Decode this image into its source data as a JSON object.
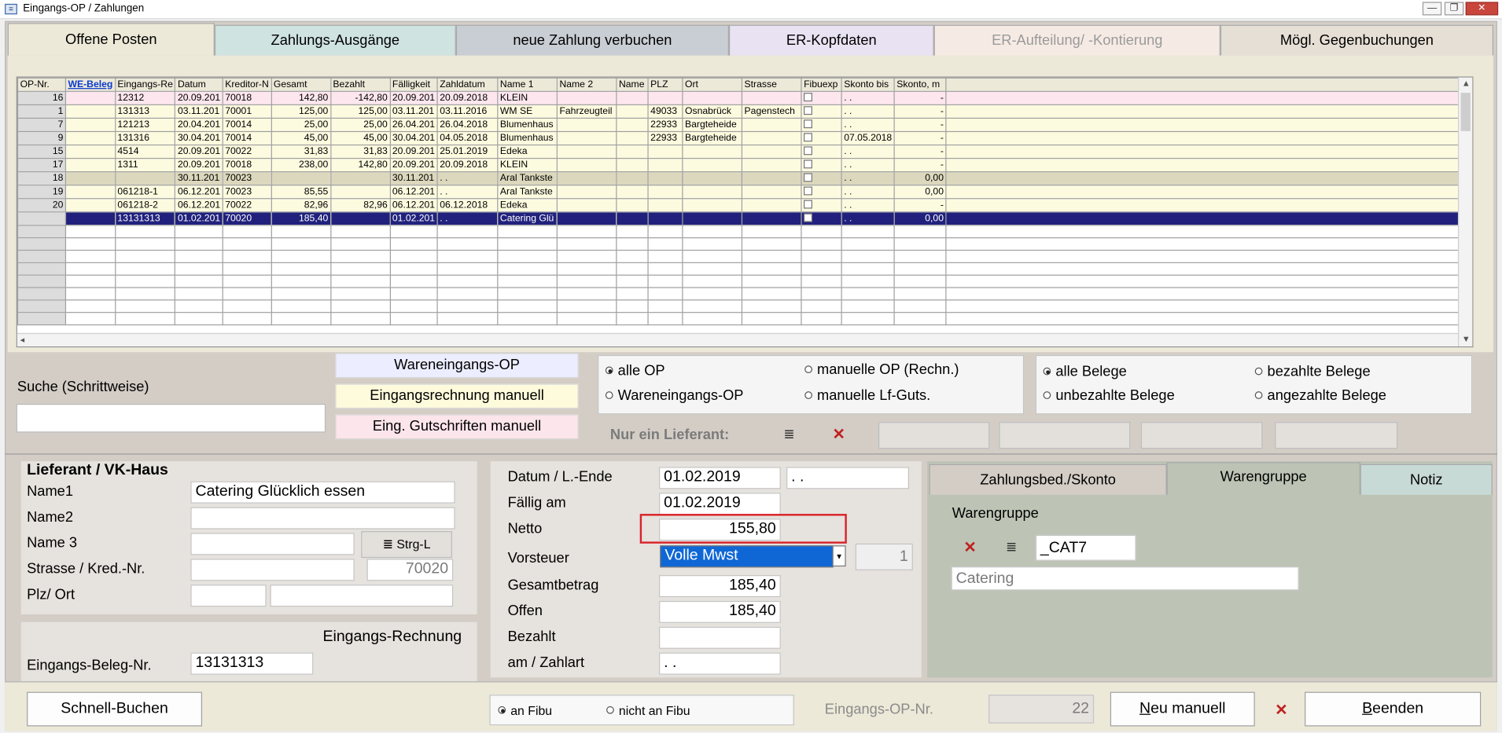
{
  "window": {
    "title": "Eingangs-OP / Zahlungen",
    "min": "—",
    "max": "❐",
    "close": "✕"
  },
  "tabs": [
    "Offene Posten",
    "Zahlungs-Ausgänge",
    "neue Zahlung verbuchen",
    "ER-Kopfdaten",
    "ER-Aufteilung/ -Kontierung",
    "Mögl. Gegenbuchungen"
  ],
  "grid": {
    "headers": [
      "OP-Nr.",
      "WE-Beleg",
      "Eingangs-Re",
      "Datum",
      "Kreditor-N",
      "Gesamt",
      "Bezahlt",
      "Fälligkeit",
      "Zahldatum",
      "Name 1",
      "Name 2",
      "Name",
      "PLZ",
      "Ort",
      "Strasse",
      "Fibuexp",
      "Skonto bis",
      "Skonto, m"
    ],
    "rows": [
      {
        "style": "pink",
        "cells": [
          "16",
          "",
          "12312",
          "20.09.201",
          "70018",
          "142,80",
          "-142,80",
          "20.09.201",
          "20.09.2018",
          "KLEIN",
          "",
          "",
          "",
          "",
          "",
          "",
          ". .",
          "-"
        ]
      },
      {
        "style": "yellow",
        "cells": [
          "1",
          "",
          "131313",
          "03.11.201",
          "70001",
          "125,00",
          "125,00",
          "03.11.201",
          "03.11.2016",
          "WM SE",
          "Fahrzeugteil",
          "",
          "49033",
          "Osnabrück",
          "Pagenstech",
          "",
          ". .",
          "-"
        ]
      },
      {
        "style": "yellow",
        "cells": [
          "7",
          "",
          "121213",
          "20.04.201",
          "70014",
          "25,00",
          "25,00",
          "26.04.201",
          "26.04.2018",
          "Blumenhaus",
          "",
          "",
          "22933",
          "Bargteheide",
          "",
          "",
          ". .",
          "-"
        ]
      },
      {
        "style": "yellow",
        "cells": [
          "9",
          "",
          "131316",
          "30.04.201",
          "70014",
          "45,00",
          "45,00",
          "30.04.201",
          "04.05.2018",
          "Blumenhaus",
          "",
          "",
          "22933",
          "Bargteheide",
          "",
          "",
          "07.05.2018",
          "-"
        ]
      },
      {
        "style": "yellow",
        "cells": [
          "15",
          "",
          "4514",
          "20.09.201",
          "70022",
          "31,83",
          "31,83",
          "20.09.201",
          "25.01.2019",
          "Edeka",
          "",
          "",
          "",
          "",
          "",
          "",
          ". .",
          "-"
        ]
      },
      {
        "style": "yellow",
        "cells": [
          "17",
          "",
          "1311",
          "20.09.201",
          "70018",
          "238,00",
          "142,80",
          "20.09.201",
          "20.09.2018",
          "KLEIN",
          "",
          "",
          "",
          "",
          "",
          "",
          ". .",
          "-"
        ]
      },
      {
        "style": "khaki",
        "cells": [
          "18",
          "",
          "",
          "30.11.201",
          "70023",
          "",
          "",
          "30.11.201",
          ". .",
          "Aral Tankste",
          "",
          "",
          "",
          "",
          "",
          "",
          ". .",
          "0,00"
        ]
      },
      {
        "style": "yellow",
        "cells": [
          "19",
          "",
          "061218-1",
          "06.12.201",
          "70023",
          "85,55",
          "",
          "06.12.201",
          ". .",
          "Aral Tankste",
          "",
          "",
          "",
          "",
          "",
          "",
          ". .",
          "0,00"
        ]
      },
      {
        "style": "yellow",
        "cells": [
          "20",
          "",
          "061218-2",
          "06.12.201",
          "70022",
          "82,96",
          "82,96",
          "06.12.201",
          "06.12.2018",
          "Edeka",
          "",
          "",
          "",
          "",
          "",
          "",
          ". .",
          "-"
        ]
      },
      {
        "style": "sel",
        "cells": [
          "",
          "",
          "13131313",
          "01.02.201",
          "70020",
          "185,40",
          "",
          "01.02.201",
          ". .",
          "Catering Glü",
          "",
          "",
          "",
          "",
          "",
          "",
          ". .",
          "0,00"
        ]
      }
    ]
  },
  "filter": {
    "search_label": "Suche (Schrittweise)",
    "search_value": "",
    "legend": [
      "Wareneingangs-OP",
      "Eingangsrechnung manuell",
      "Eing. Gutschriften manuell"
    ],
    "op_radios": [
      "alle OP",
      "manuelle OP (Rechn.)",
      "Wareneingangs-OP",
      "manuelle Lf-Guts."
    ],
    "beleg_radios": [
      "alle Belege",
      "bezahlte Belege",
      "unbezahlte Belege",
      "angezahlte Belege"
    ],
    "nur_lieferant": "Nur ein Lieferant:"
  },
  "lieferant": {
    "heading": "Lieferant / VK-Haus",
    "labels": [
      "Name1",
      "Name2",
      "Name 3",
      "Strasse / Kred.-Nr.",
      "Plz/ Ort"
    ],
    "name1": "Catering Glücklich essen",
    "strg_label": "Strg-L",
    "kred_nr": "70020",
    "eingangs_rechnung_heading": "Eingangs-Rechnung",
    "beleg_label": "Eingangs-Beleg-Nr.",
    "beleg_value": "13131313"
  },
  "beleg": {
    "labels": [
      "Datum / L.-Ende",
      "Fällig am",
      "Netto",
      "Vorsteuer",
      "Gesamtbetrag",
      "Offen",
      "Bezahlt",
      "am / Zahlart"
    ],
    "datum": "01.02.2019",
    "l_ende": ". .",
    "faellig": "01.02.2019",
    "netto": "155,80",
    "vorsteuer": "Volle Mwst",
    "vorsteuer_code": "1",
    "gesamt": "185,40",
    "offen": "185,40",
    "bezahlt": "",
    "am": ". ."
  },
  "rightpanel": {
    "tabs": [
      "Zahlungsbed./Skonto",
      "Warengruppe",
      "Notiz"
    ],
    "warengruppe_label": "Warengruppe",
    "code": "_CAT7",
    "desc": "Catering"
  },
  "footer": {
    "schnell": "Schnell-Buchen",
    "fibu_radios": [
      "an Fibu",
      "nicht an Fibu"
    ],
    "op_nr_label": "Eingangs-OP-Nr.",
    "op_nr_value": "22",
    "neu": "Neu manuell",
    "beenden": "Beenden"
  },
  "colors": {
    "selected_row": "#21217d",
    "highlight": "#d9232a",
    "select_blue": "#0f67d6"
  }
}
